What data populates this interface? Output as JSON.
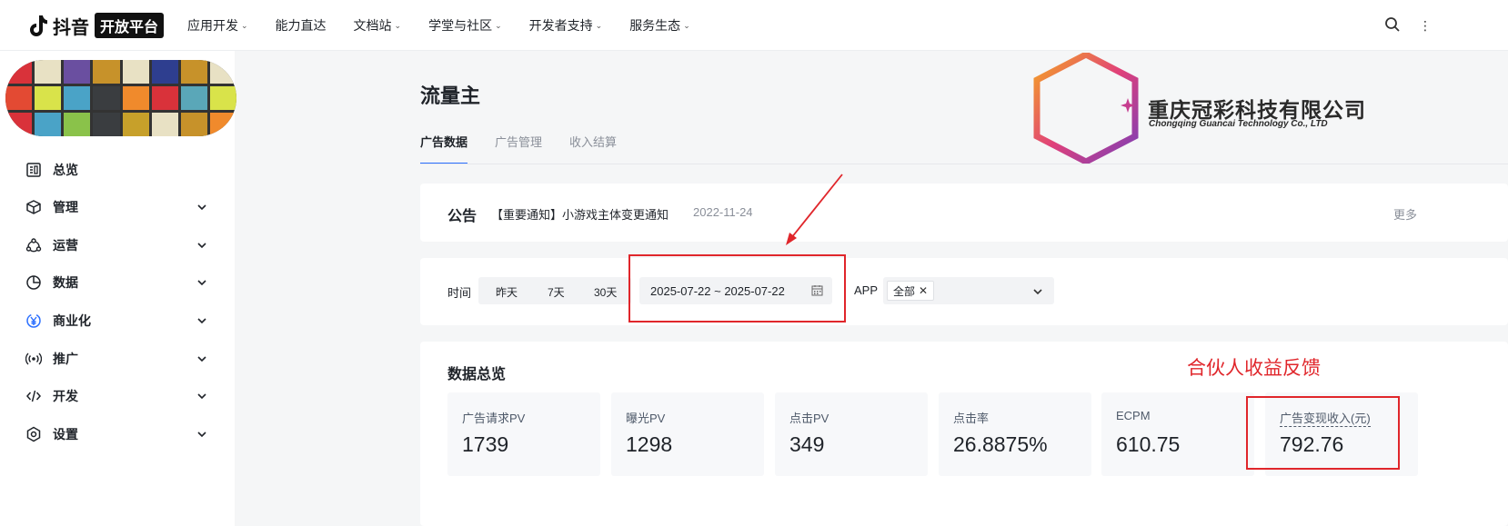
{
  "brand": {
    "name": "抖音",
    "tag": "开放平台"
  },
  "topnav": {
    "items": [
      {
        "label": "应用开发",
        "dropdown": true
      },
      {
        "label": "能力直达",
        "dropdown": false
      },
      {
        "label": "文档站",
        "dropdown": true
      },
      {
        "label": "学堂与社区",
        "dropdown": true
      },
      {
        "label": "开发者支持",
        "dropdown": true
      },
      {
        "label": "服务生态",
        "dropdown": true
      }
    ],
    "search_icon": "search-icon"
  },
  "sidebar": {
    "items": [
      {
        "label": "总览",
        "icon": "dashboard-icon",
        "expandable": false
      },
      {
        "label": "管理",
        "icon": "cube-icon",
        "expandable": true
      },
      {
        "label": "运营",
        "icon": "operations-icon",
        "expandable": true
      },
      {
        "label": "数据",
        "icon": "pie-chart-icon",
        "expandable": true
      },
      {
        "label": "商业化",
        "icon": "yen-icon",
        "expandable": true
      },
      {
        "label": "推广",
        "icon": "broadcast-icon",
        "expandable": true
      },
      {
        "label": "开发",
        "icon": "code-icon",
        "expandable": true
      },
      {
        "label": "设置",
        "icon": "settings-icon",
        "expandable": true
      }
    ]
  },
  "main": {
    "title": "流量主",
    "tabs": [
      {
        "label": "广告数据",
        "active": true
      },
      {
        "label": "广告管理",
        "active": false
      },
      {
        "label": "收入结算",
        "active": false
      }
    ],
    "notice": {
      "label": "公告",
      "text": "【重要通知】小游戏主体变更通知",
      "date": "2022-11-24",
      "more": "更多"
    },
    "filter": {
      "time_label": "时间",
      "quick_ranges": [
        "昨天",
        "7天",
        "30天"
      ],
      "date_range": "2025-07-22 ~ 2025-07-22",
      "app_label": "APP",
      "app_selected": "全部"
    },
    "overview": {
      "title": "数据总览",
      "metrics": [
        {
          "label": "广告请求PV",
          "value": "1739"
        },
        {
          "label": "曝光PV",
          "value": "1298"
        },
        {
          "label": "点击PV",
          "value": "349"
        },
        {
          "label": "点击率",
          "value": "26.8875%"
        },
        {
          "label": "ECPM",
          "value": "610.75"
        },
        {
          "label": "广告变现收入(元)",
          "value": "792.76"
        }
      ]
    }
  },
  "annotation": {
    "note": "合伙人收益反馈",
    "color": "#e0262b"
  },
  "company_logo": {
    "name": "重庆冠彩科技有限公司",
    "name_en": "Chongqing Guancai Technology Co., LTD"
  },
  "colors": {
    "accent": "#2b6fff",
    "text": "#1f2329",
    "muted": "#8a8f99"
  }
}
